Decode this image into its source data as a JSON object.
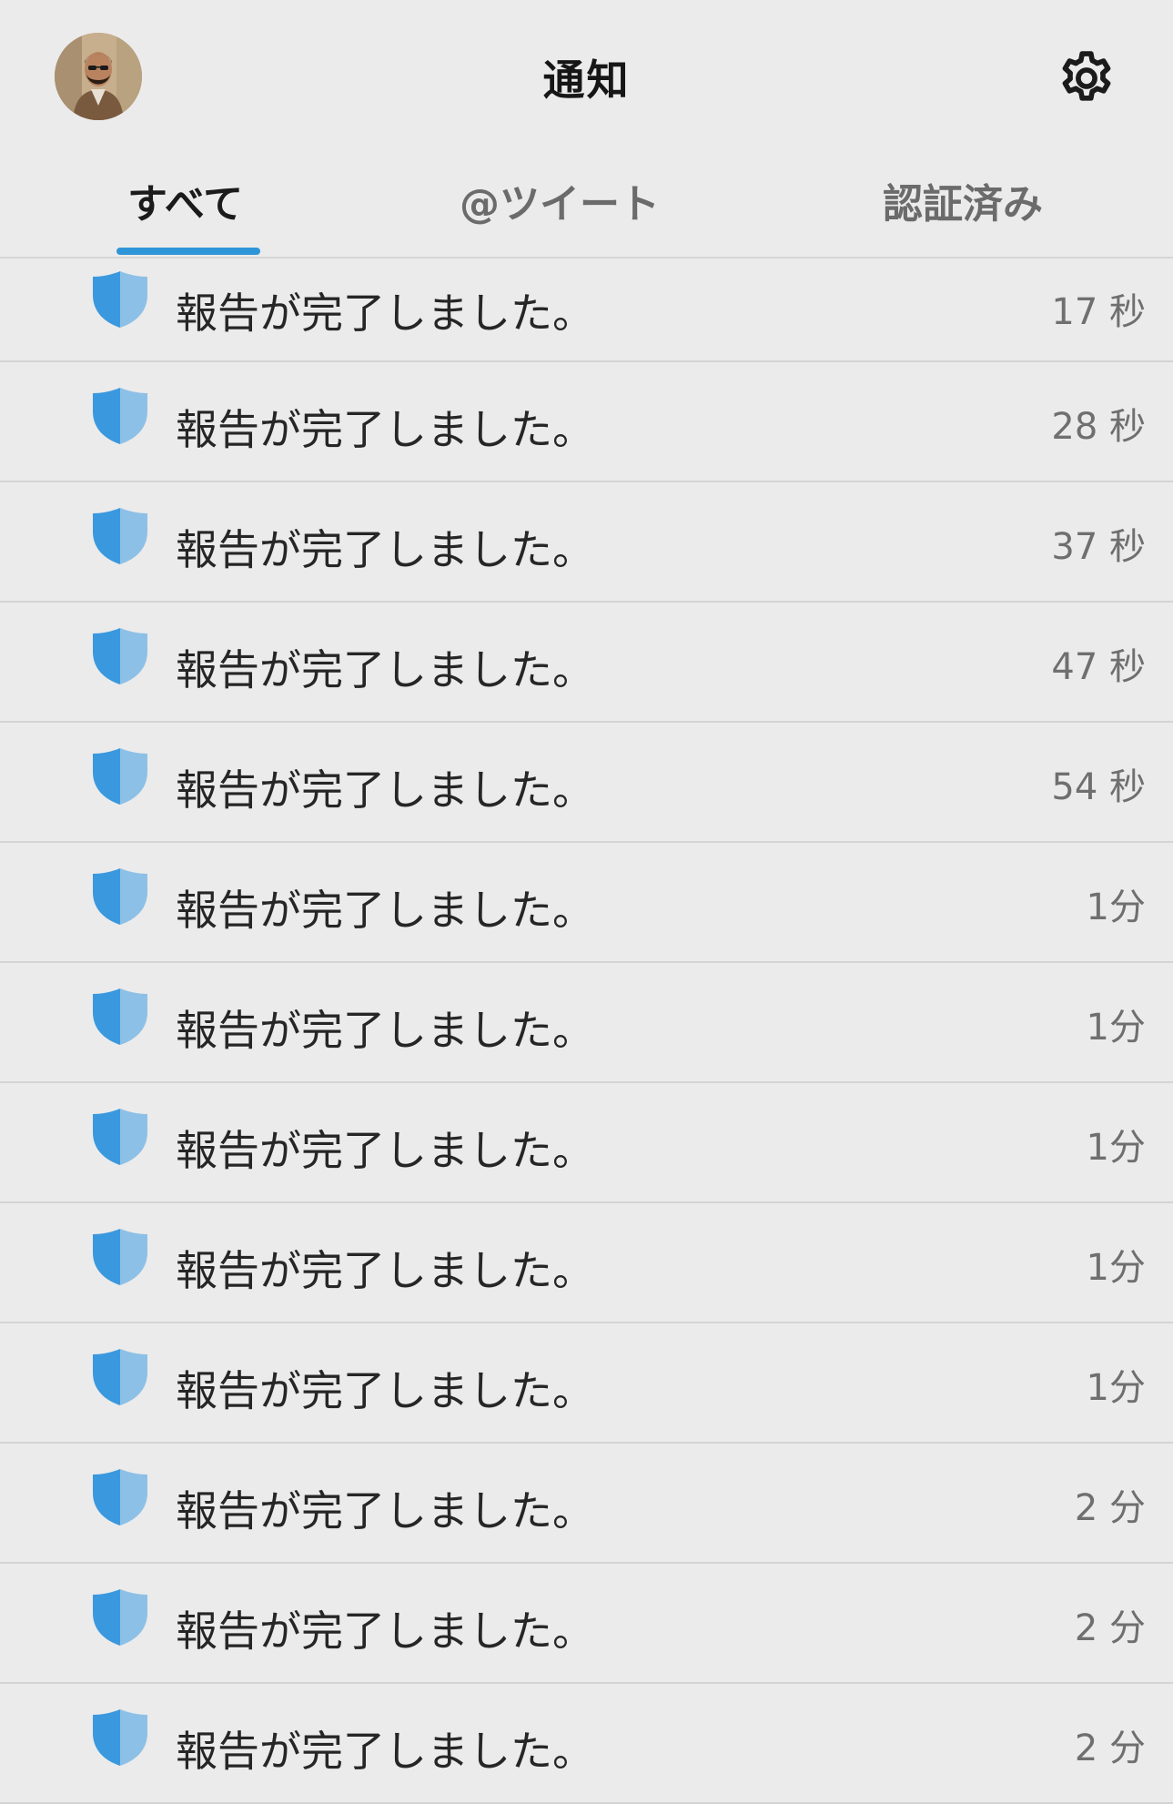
{
  "header": {
    "title": "通知",
    "avatar_icon": "profile-photo",
    "settings_icon": "gear-icon"
  },
  "tabs": [
    {
      "label": "すべて",
      "active": true
    },
    {
      "label": "@ツイート",
      "active": false
    },
    {
      "label": "認証済み",
      "active": false
    }
  ],
  "colors": {
    "accent": "#2e96d8",
    "shield_dark": "#3a98de",
    "shield_light": "#8dc0e6",
    "background": "#ebebeb"
  },
  "notifications": [
    {
      "icon": "shield-icon",
      "message": "報告が完了しました。",
      "time": "17 秒"
    },
    {
      "icon": "shield-icon",
      "message": "報告が完了しました。",
      "time": "28 秒"
    },
    {
      "icon": "shield-icon",
      "message": "報告が完了しました。",
      "time": "37 秒"
    },
    {
      "icon": "shield-icon",
      "message": "報告が完了しました。",
      "time": "47 秒"
    },
    {
      "icon": "shield-icon",
      "message": "報告が完了しました。",
      "time": "54 秒"
    },
    {
      "icon": "shield-icon",
      "message": "報告が完了しました。",
      "time": "1分"
    },
    {
      "icon": "shield-icon",
      "message": "報告が完了しました。",
      "time": "1分"
    },
    {
      "icon": "shield-icon",
      "message": "報告が完了しました。",
      "time": "1分"
    },
    {
      "icon": "shield-icon",
      "message": "報告が完了しました。",
      "time": "1分"
    },
    {
      "icon": "shield-icon",
      "message": "報告が完了しました。",
      "time": "1分"
    },
    {
      "icon": "shield-icon",
      "message": "報告が完了しました。",
      "time": "2 分"
    },
    {
      "icon": "shield-icon",
      "message": "報告が完了しました。",
      "time": "2 分"
    },
    {
      "icon": "shield-icon",
      "message": "報告が完了しました。",
      "time": "2 分"
    }
  ]
}
